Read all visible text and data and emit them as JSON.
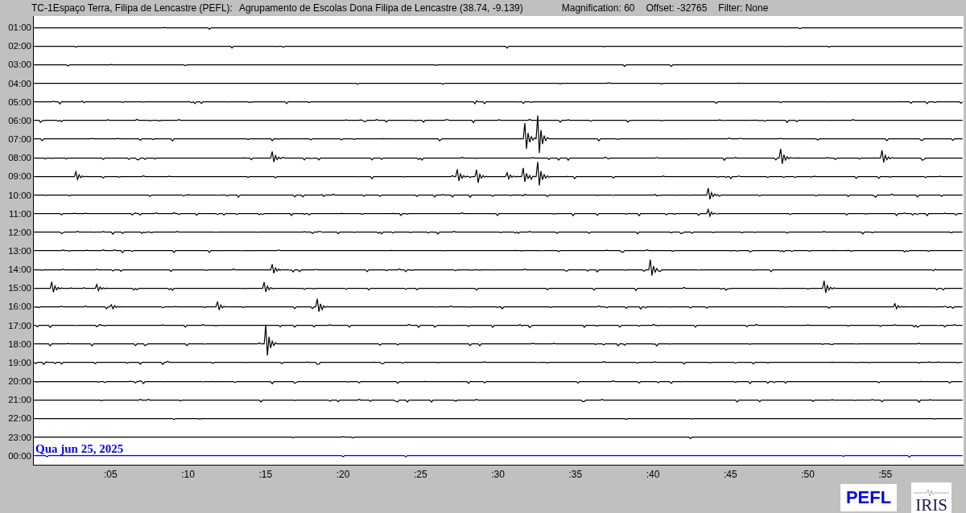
{
  "header": {
    "station": "TC-1Espaço Terra, Filipa de Lencastre (PEFL):",
    "location": "Agrupamento de Escolas Dona Filipa de Lencastre (38.74, -9.139)",
    "magnification": "Magnification: 60",
    "offset": "Offset: -32765",
    "filter": "Filter: None"
  },
  "rows": [
    {
      "label": "01:00",
      "color": "#000000"
    },
    {
      "label": "02:00",
      "color": "#000000"
    },
    {
      "label": "03:00",
      "color": "#000000"
    },
    {
      "label": "04:00",
      "color": "#000000"
    },
    {
      "label": "05:00",
      "color": "#000000"
    },
    {
      "label": "06:00",
      "color": "#000000"
    },
    {
      "label": "07:00",
      "color": "#000000"
    },
    {
      "label": "08:00",
      "color": "#000000"
    },
    {
      "label": "09:00",
      "color": "#000000"
    },
    {
      "label": "10:00",
      "color": "#000000"
    },
    {
      "label": "11:00",
      "color": "#000000"
    },
    {
      "label": "12:00",
      "color": "#000000"
    },
    {
      "label": "13:00",
      "color": "#000000"
    },
    {
      "label": "14:00",
      "color": "#000000"
    },
    {
      "label": "15:00",
      "color": "#000000"
    },
    {
      "label": "16:00",
      "color": "#000000"
    },
    {
      "label": "17:00",
      "color": "#000000"
    },
    {
      "label": "18:00",
      "color": "#000000"
    },
    {
      "label": "19:00",
      "color": "#000000"
    },
    {
      "label": "20:00",
      "color": "#000000"
    },
    {
      "label": "21:00",
      "color": "#000000"
    },
    {
      "label": "22:00",
      "color": "#000000"
    },
    {
      "label": "23:00",
      "color": "#000000"
    },
    {
      "label": "00:00",
      "color": "#0000ff"
    }
  ],
  "date_label": "Qua jun 25, 2025",
  "x_ticks": [
    ":05",
    ":10",
    ":15",
    ":20",
    ":25",
    ":30",
    ":35",
    ":40",
    ":45",
    ":50",
    ":55"
  ],
  "logos": {
    "station": "PEFL",
    "network": "IRIS"
  }
}
